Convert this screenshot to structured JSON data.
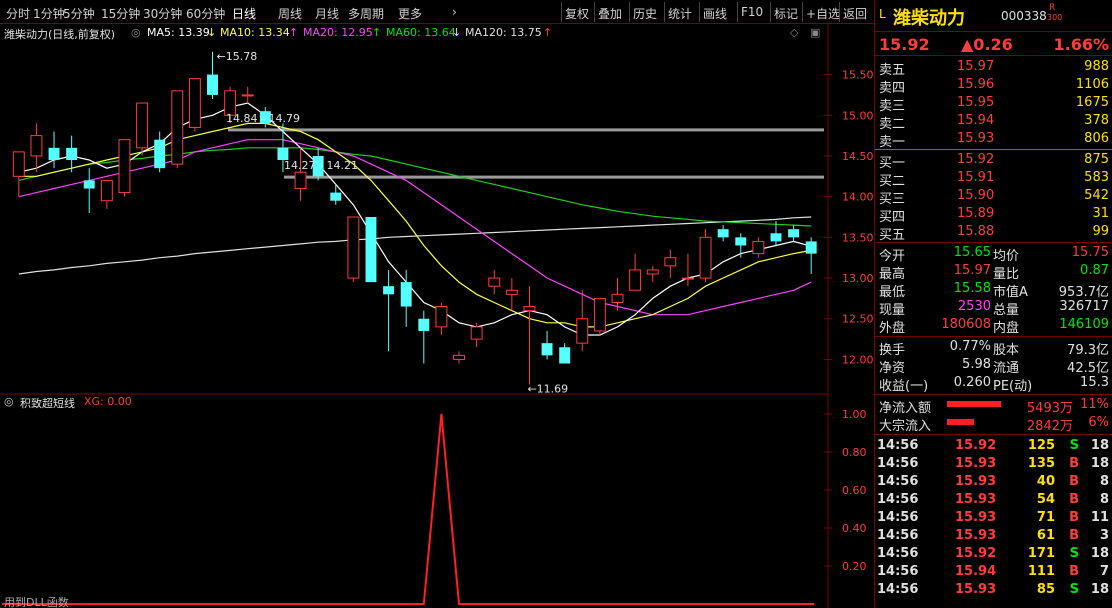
{
  "toolbar": {
    "left": [
      "分时",
      "1分钟",
      "5分钟",
      "15分钟",
      "30分钟",
      "60分钟",
      "日线",
      "周线",
      "月线",
      "多周期",
      "更多"
    ],
    "active": "日线",
    "right": [
      "复权",
      "叠加",
      "历史",
      "统计",
      "画线",
      "F10",
      "标记",
      "+自选",
      "返回"
    ]
  },
  "info": {
    "name": "潍柴动力(日线,前复权)",
    "ma5": "MA5: 13.39",
    "ma10": "MA10: 13.34",
    "ma20": "MA20: 12.95",
    "ma60": "MA60: 13.64",
    "ma120": "MA120: 13.75",
    "arrow_down": "↓",
    "arrow_up": "↑"
  },
  "colors": {
    "ma5": "#ffffff",
    "ma10": "#ffff40",
    "ma20": "#ff40ff",
    "ma60": "#20d020",
    "ma120": "#e0e0e0",
    "up": "#ff3c3c",
    "down": "#54ffff",
    "grid": "#7a0000"
  },
  "annotations": {
    "high": "15.78",
    "low": "11.69",
    "line1": "14.84 - 14.79",
    "line2": "14.27 - 14.21"
  },
  "price_axis": [
    "15.50",
    "15.00",
    "14.50",
    "14.00",
    "13.50",
    "13.00",
    "12.50",
    "12.00"
  ],
  "sub_axis": [
    "1.00",
    "0.80",
    "0.60",
    "0.40",
    "0.20"
  ],
  "sub": {
    "title": "积致超短线",
    "xg": "XG: 0.00",
    "dll": "用到DLL函数"
  },
  "chart_data": {
    "type": "candlestick",
    "ylim": [
      11.6,
      15.9
    ],
    "candles": [
      {
        "o": 14.25,
        "h": 14.55,
        "l": 14.0,
        "c": 14.55
      },
      {
        "o": 14.5,
        "h": 14.9,
        "l": 14.3,
        "c": 14.75
      },
      {
        "o": 14.6,
        "h": 14.8,
        "l": 14.35,
        "c": 14.45
      },
      {
        "o": 14.6,
        "h": 14.75,
        "l": 14.3,
        "c": 14.45
      },
      {
        "o": 14.2,
        "h": 14.35,
        "l": 13.8,
        "c": 14.1
      },
      {
        "o": 13.95,
        "h": 14.2,
        "l": 13.85,
        "c": 14.2
      },
      {
        "o": 14.05,
        "h": 14.7,
        "l": 14.0,
        "c": 14.7
      },
      {
        "o": 14.6,
        "h": 15.0,
        "l": 14.5,
        "c": 15.15
      },
      {
        "o": 14.7,
        "h": 14.8,
        "l": 14.3,
        "c": 14.35
      },
      {
        "o": 14.4,
        "h": 15.3,
        "l": 14.35,
        "c": 15.3
      },
      {
        "o": 14.85,
        "h": 15.45,
        "l": 14.8,
        "c": 15.45
      },
      {
        "o": 15.5,
        "h": 15.78,
        "l": 15.2,
        "c": 15.25
      },
      {
        "o": 15.0,
        "h": 15.35,
        "l": 14.9,
        "c": 15.3
      },
      {
        "o": 15.25,
        "h": 15.35,
        "l": 15.15,
        "c": 15.25
      },
      {
        "o": 15.05,
        "h": 15.1,
        "l": 14.85,
        "c": 14.9
      },
      {
        "o": 14.6,
        "h": 14.9,
        "l": 14.3,
        "c": 14.45
      },
      {
        "o": 14.1,
        "h": 14.6,
        "l": 13.95,
        "c": 14.3
      },
      {
        "o": 14.5,
        "h": 14.6,
        "l": 14.2,
        "c": 14.25
      },
      {
        "o": 14.05,
        "h": 14.15,
        "l": 13.9,
        "c": 13.95
      },
      {
        "o": 13.0,
        "h": 13.7,
        "l": 12.95,
        "c": 13.75
      },
      {
        "o": 13.75,
        "h": 13.75,
        "l": 12.95,
        "c": 12.95
      },
      {
        "o": 12.9,
        "h": 13.1,
        "l": 12.1,
        "c": 12.8
      },
      {
        "o": 12.95,
        "h": 13.1,
        "l": 12.4,
        "c": 12.65
      },
      {
        "o": 12.5,
        "h": 12.6,
        "l": 11.95,
        "c": 12.35
      },
      {
        "o": 12.4,
        "h": 12.7,
        "l": 12.3,
        "c": 12.65
      },
      {
        "o": 12.0,
        "h": 12.1,
        "l": 11.95,
        "c": 12.05
      },
      {
        "o": 12.25,
        "h": 12.45,
        "l": 12.15,
        "c": 12.4
      },
      {
        "o": 12.9,
        "h": 13.1,
        "l": 12.8,
        "c": 13.0
      },
      {
        "o": 12.8,
        "h": 13.0,
        "l": 12.6,
        "c": 12.85
      },
      {
        "o": 12.6,
        "h": 12.9,
        "l": 11.69,
        "c": 12.65
      },
      {
        "o": 12.2,
        "h": 12.35,
        "l": 12.0,
        "c": 12.05
      },
      {
        "o": 12.15,
        "h": 12.2,
        "l": 11.95,
        "c": 11.95
      },
      {
        "o": 12.2,
        "h": 12.85,
        "l": 12.1,
        "c": 12.5
      },
      {
        "o": 12.35,
        "h": 12.75,
        "l": 12.3,
        "c": 12.75
      },
      {
        "o": 12.7,
        "h": 13.0,
        "l": 12.6,
        "c": 12.8
      },
      {
        "o": 12.85,
        "h": 13.3,
        "l": 12.85,
        "c": 13.1
      },
      {
        "o": 13.05,
        "h": 13.15,
        "l": 12.95,
        "c": 13.1
      },
      {
        "o": 13.15,
        "h": 13.35,
        "l": 13.0,
        "c": 13.25
      },
      {
        "o": 13.0,
        "h": 13.3,
        "l": 12.9,
        "c": 13.0
      },
      {
        "o": 13.0,
        "h": 13.6,
        "l": 12.95,
        "c": 13.5
      },
      {
        "o": 13.6,
        "h": 13.65,
        "l": 13.45,
        "c": 13.5
      },
      {
        "o": 13.5,
        "h": 13.55,
        "l": 13.25,
        "c": 13.4
      },
      {
        "o": 13.3,
        "h": 13.5,
        "l": 13.25,
        "c": 13.45
      },
      {
        "o": 13.55,
        "h": 13.7,
        "l": 13.4,
        "c": 13.45
      },
      {
        "o": 13.6,
        "h": 13.65,
        "l": 13.45,
        "c": 13.5
      },
      {
        "o": 13.45,
        "h": 13.5,
        "l": 13.05,
        "c": 13.3
      }
    ],
    "ma5": [
      14.3,
      14.35,
      14.45,
      14.5,
      14.45,
      14.35,
      14.4,
      14.55,
      14.65,
      14.85,
      14.95,
      15.0,
      15.1,
      15.15,
      15.0,
      14.8,
      14.6,
      14.4,
      14.15,
      13.9,
      13.55,
      13.2,
      12.95,
      12.7,
      12.6,
      12.45,
      12.4,
      12.45,
      12.55,
      12.6,
      12.55,
      12.4,
      12.3,
      12.3,
      12.4,
      12.55,
      12.75,
      12.9,
      13.0,
      13.05,
      13.2,
      13.3,
      13.35,
      13.4,
      13.45,
      13.39
    ],
    "ma10": [
      14.25,
      14.25,
      14.3,
      14.35,
      14.4,
      14.45,
      14.5,
      14.55,
      14.6,
      14.7,
      14.75,
      14.8,
      14.85,
      14.9,
      14.9,
      14.85,
      14.8,
      14.7,
      14.55,
      14.4,
      14.2,
      13.95,
      13.7,
      13.4,
      13.15,
      12.95,
      12.8,
      12.7,
      12.6,
      12.5,
      12.45,
      12.45,
      12.4,
      12.4,
      12.45,
      12.5,
      12.55,
      12.65,
      12.75,
      12.9,
      13.0,
      13.1,
      13.2,
      13.25,
      13.3,
      13.34
    ],
    "ma20": [
      14.0,
      14.05,
      14.1,
      14.15,
      14.2,
      14.25,
      14.3,
      14.35,
      14.4,
      14.45,
      14.55,
      14.6,
      14.65,
      14.7,
      14.7,
      14.7,
      14.65,
      14.6,
      14.55,
      14.5,
      14.4,
      14.3,
      14.2,
      14.05,
      13.9,
      13.75,
      13.6,
      13.45,
      13.3,
      13.15,
      13.0,
      12.9,
      12.8,
      12.7,
      12.65,
      12.6,
      12.55,
      12.55,
      12.55,
      12.6,
      12.65,
      12.7,
      12.75,
      12.8,
      12.85,
      12.95
    ],
    "ma60": [
      14.2,
      14.25,
      14.3,
      14.35,
      14.4,
      14.42,
      14.45,
      14.47,
      14.5,
      14.52,
      14.55,
      14.57,
      14.58,
      14.6,
      14.6,
      14.6,
      14.6,
      14.58,
      14.55,
      14.52,
      14.5,
      14.45,
      14.4,
      14.35,
      14.3,
      14.25,
      14.2,
      14.15,
      14.1,
      14.05,
      14.0,
      13.95,
      13.9,
      13.86,
      13.82,
      13.79,
      13.76,
      13.74,
      13.72,
      13.7,
      13.69,
      13.68,
      13.67,
      13.66,
      13.65,
      13.64
    ],
    "ma120": [
      13.05,
      13.08,
      13.1,
      13.13,
      13.15,
      13.18,
      13.2,
      13.22,
      13.25,
      13.27,
      13.3,
      13.32,
      13.34,
      13.36,
      13.38,
      13.4,
      13.42,
      13.44,
      13.45,
      13.47,
      13.48,
      13.5,
      13.51,
      13.52,
      13.53,
      13.54,
      13.55,
      13.56,
      13.57,
      13.58,
      13.59,
      13.6,
      13.61,
      13.62,
      13.63,
      13.64,
      13.65,
      13.66,
      13.67,
      13.68,
      13.69,
      13.7,
      13.71,
      13.72,
      13.74,
      13.75
    ],
    "sub_signal": {
      "peak_index": 24,
      "peak_value": 1.0,
      "ylim": [
        0,
        1.0
      ]
    }
  },
  "right": {
    "market_tag": "L",
    "name": "潍柴动力",
    "code": "000338",
    "code_tag": "R",
    "code_sub": "300",
    "price": "15.92",
    "change": "▲0.26",
    "pct": "1.66%",
    "asks": [
      {
        "label": "卖五",
        "price": "15.97",
        "vol": "988"
      },
      {
        "label": "卖四",
        "price": "15.96",
        "vol": "1106"
      },
      {
        "label": "卖三",
        "price": "15.95",
        "vol": "1675"
      },
      {
        "label": "卖二",
        "price": "15.94",
        "vol": "378"
      },
      {
        "label": "卖一",
        "price": "15.93",
        "vol": "806"
      }
    ],
    "bids": [
      {
        "label": "买一",
        "price": "15.92",
        "vol": "875"
      },
      {
        "label": "买二",
        "price": "15.91",
        "vol": "583"
      },
      {
        "label": "买三",
        "price": "15.90",
        "vol": "542"
      },
      {
        "label": "买四",
        "price": "15.89",
        "vol": "31"
      },
      {
        "label": "买五",
        "price": "15.88",
        "vol": "99"
      }
    ],
    "stats": [
      {
        "l1": "今开",
        "v1": "15.65",
        "c1": "grn",
        "l2": "均价",
        "v2": "15.75",
        "c2": "red"
      },
      {
        "l1": "最高",
        "v1": "15.97",
        "c1": "red",
        "l2": "量比",
        "v2": "0.87",
        "c2": "grn"
      },
      {
        "l1": "最低",
        "v1": "15.58",
        "c1": "grn",
        "l2": "市值A",
        "v2": "953.7亿",
        "c2": "wht"
      },
      {
        "l1": "现量",
        "v1": "2530",
        "c1": "mag",
        "l2": "总量",
        "v2": "326717",
        "c2": "wht"
      },
      {
        "l1": "外盘",
        "v1": "180608",
        "c1": "red",
        "l2": "内盘",
        "v2": "146109",
        "c2": "grn"
      }
    ],
    "stats2": [
      {
        "l1": "换手",
        "v1": "0.77%",
        "l2": "股本",
        "v2": "79.3亿"
      },
      {
        "l1": "净资",
        "v1": "5.98",
        "l2": "流通",
        "v2": "42.5亿"
      },
      {
        "l1": "收益(一)",
        "v1": "0.260",
        "l2": "PE(动)",
        "v2": "15.3"
      }
    ],
    "flows": [
      {
        "label": "净流入额",
        "value": "5493万",
        "pct": "11%",
        "bar": 1.0
      },
      {
        "label": "大宗流入",
        "value": "2842万",
        "pct": "6%",
        "bar": 0.5
      }
    ],
    "ticks": [
      {
        "t": "14:56",
        "p": "15.92",
        "pc": "red",
        "v": "125",
        "s": "S",
        "n": "18"
      },
      {
        "t": "14:56",
        "p": "15.93",
        "pc": "red",
        "v": "135",
        "s": "B",
        "n": "18"
      },
      {
        "t": "14:56",
        "p": "15.93",
        "pc": "red",
        "v": "40",
        "s": "B",
        "n": "8"
      },
      {
        "t": "14:56",
        "p": "15.93",
        "pc": "red",
        "v": "54",
        "s": "B",
        "n": "8"
      },
      {
        "t": "14:56",
        "p": "15.93",
        "pc": "red",
        "v": "71",
        "s": "B",
        "n": "11"
      },
      {
        "t": "14:56",
        "p": "15.93",
        "pc": "red",
        "v": "61",
        "s": "B",
        "n": "3"
      },
      {
        "t": "14:56",
        "p": "15.92",
        "pc": "red",
        "v": "171",
        "s": "S",
        "n": "18"
      },
      {
        "t": "14:56",
        "p": "15.94",
        "pc": "red",
        "v": "111",
        "s": "B",
        "n": "7"
      },
      {
        "t": "14:56",
        "p": "15.93",
        "pc": "red",
        "v": "85",
        "s": "S",
        "n": "18"
      }
    ]
  }
}
